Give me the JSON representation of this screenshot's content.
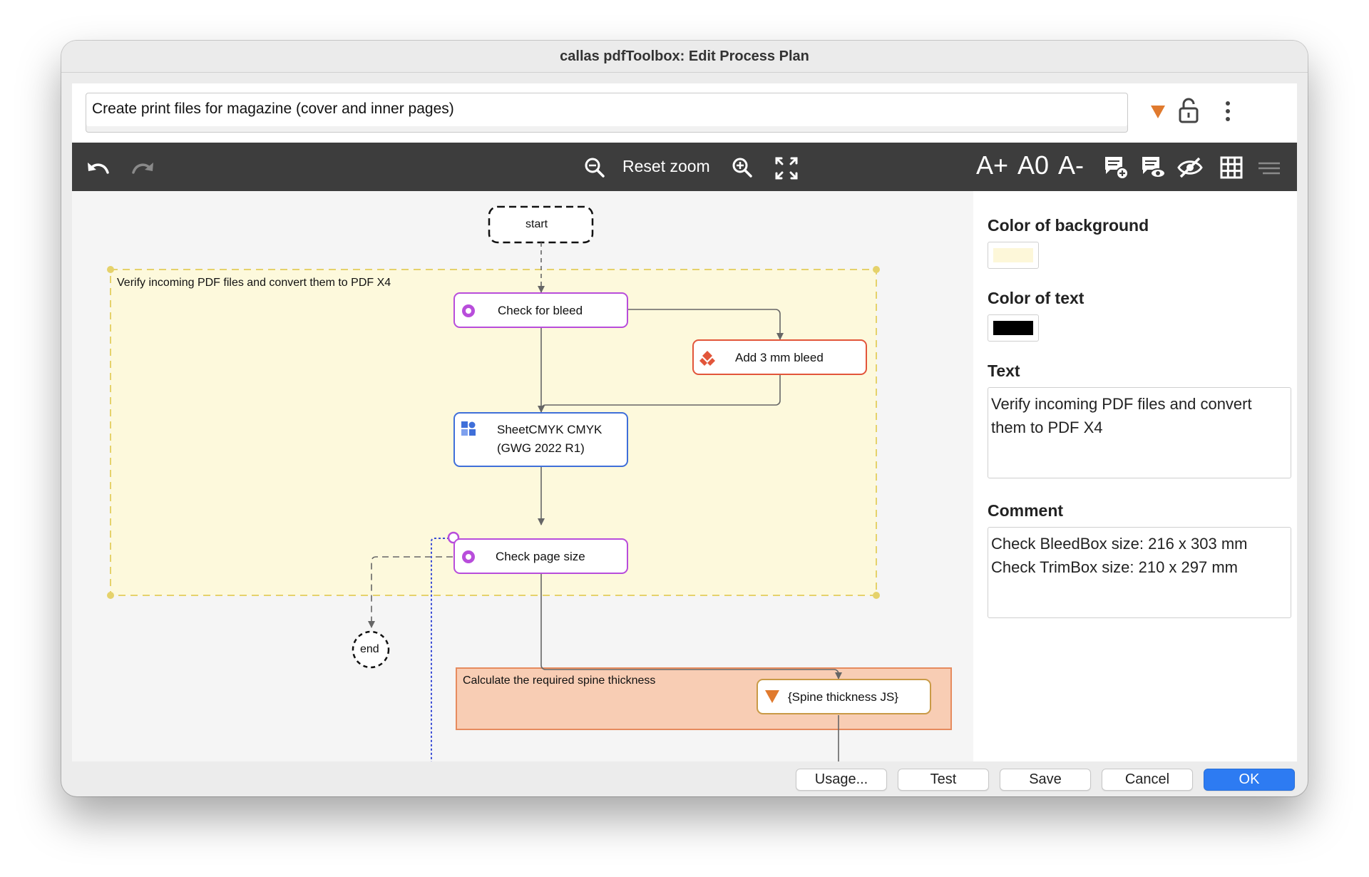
{
  "window": {
    "title": "callas pdfToolbox: Edit Process Plan"
  },
  "top": {
    "plan_name": "Create print files for magazine (cover and inner pages)",
    "icons": [
      "triangle-orange-icon",
      "lock-open-icon",
      "more-vertical-icon"
    ]
  },
  "toolbar": {
    "reset_zoom": "Reset zoom",
    "font_increase": "A+",
    "font_reset": "A0",
    "font_decrease": "A-",
    "icons": [
      "undo-icon",
      "redo-icon",
      "zoom-out-icon",
      "zoom-in-icon",
      "fit-screen-icon",
      "add-comment-icon",
      "show-comments-icon",
      "hide-icon",
      "grid-icon",
      "align-icon"
    ]
  },
  "flow": {
    "start": "start",
    "end": "end",
    "group1_label": "Verify incoming PDF files and convert them to PDF X4",
    "group2_label": "Calculate the required spine thickness",
    "nodes": {
      "check_bleed": "Check for bleed",
      "add_bleed": "Add 3 mm bleed",
      "sheet_line1": "SheetCMYK CMYK",
      "sheet_line2": "(GWG 2022 R1)",
      "check_page_size": "Check page size",
      "spine_js": "{Spine thickness JS}"
    }
  },
  "properties": {
    "bg_label": "Color of background",
    "bg_color": "#fdf7d9",
    "text_color_label": "Color of text",
    "text_color": "#000000",
    "text_label": "Text",
    "text_value": "Verify incoming PDF files and convert them to PDF X4",
    "comment_label": "Comment",
    "comment_value": "Check BleedBox size: 216 x 303 mm\nCheck TrimBox size: 210 x 297 mm"
  },
  "buttons": {
    "usage": "Usage...",
    "test": "Test",
    "save": "Save",
    "cancel": "Cancel",
    "ok": "OK"
  },
  "colors": {
    "accent": "#2d7bf2",
    "check_node": "#b84ddb",
    "fix_node": "#e2553a",
    "profile_node": "#3f6fd9",
    "js_node": "#c99a46"
  }
}
